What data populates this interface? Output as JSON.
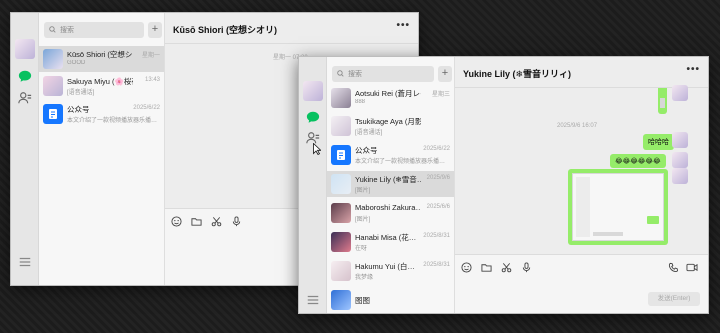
{
  "colors": {
    "accent_green": "#07c160",
    "bubble_green": "#95ec69",
    "link_blue": "#3b78d6"
  },
  "window1": {
    "search_placeholder": "搜索",
    "plus_label": "+",
    "chat_title": "Kūsō Shiori (空想シオリ)",
    "more_label": "•••",
    "timestamp": "星期一 07:30",
    "conversations": [
      {
        "name": "Kūsō Shiori (空想シオリ)",
        "preview": "GOOD",
        "time": "星期一",
        "selected": true
      },
      {
        "name": "Sakuya Miyu (🌸桜夜…",
        "preview": "[语音通话]",
        "time": "13:43",
        "selected": false
      },
      {
        "name": "公众号",
        "preview": "本文介绍了一款视频播放器乐播…",
        "time": "2025/6/22",
        "selected": false,
        "highlight": true
      }
    ]
  },
  "window2": {
    "search_placeholder": "搜索",
    "plus_label": "+",
    "chat_title": "Yukine Lily (❄雪音リリィ)",
    "more_label": "•••",
    "timestamp": "2025/9/6 16:07",
    "send_label": "发送(Enter)",
    "conversations": [
      {
        "name": "Aotsuki Rei (蒼月レイ)",
        "preview": "888",
        "time": "星期三",
        "selected": false
      },
      {
        "name": "Tsukikage Aya (月影…",
        "preview": "[语音通话]",
        "time": "",
        "selected": false
      },
      {
        "name": "公众号",
        "preview": "本文介绍了一款视频播放器乐播…",
        "time": "2025/6/22",
        "selected": false,
        "highlight": true
      },
      {
        "name": "Yukine Lily (❄雪音…",
        "preview": "[图片]",
        "time": "2025/9/6",
        "selected": true
      },
      {
        "name": "Maboroshi Zakura…",
        "preview": "[图片]",
        "time": "2025/6/6",
        "selected": false
      },
      {
        "name": "Hanabi Misa (花…",
        "preview": "在呀",
        "time": "2025/8/31",
        "selected": false
      },
      {
        "name": "Hakumu Yui (白…",
        "preview": "我梦缘",
        "time": "2025/8/31",
        "selected": false
      },
      {
        "name": "图图",
        "preview": "",
        "time": "",
        "selected": false
      }
    ],
    "messages": {
      "laugh": "哈哈哈",
      "emoji_row": "😂😂😂😂😂😂"
    }
  }
}
